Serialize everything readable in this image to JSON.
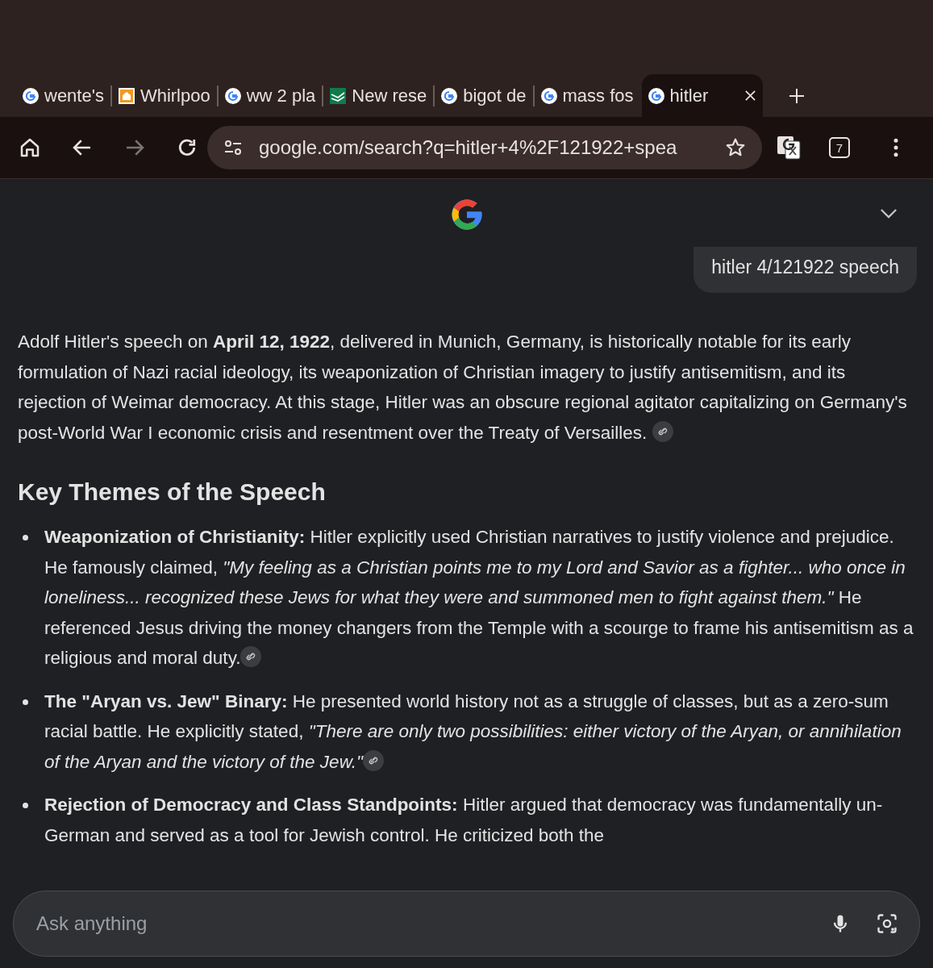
{
  "browser": {
    "tabs": [
      {
        "title": "wente's",
        "kind": "google",
        "selected": false
      },
      {
        "title": "Whirlpoo",
        "kind": "house",
        "selected": false
      },
      {
        "title": "ww 2 pla",
        "kind": "google",
        "selected": false
      },
      {
        "title": "New rese",
        "kind": "sheet",
        "selected": false
      },
      {
        "title": "bigot de",
        "kind": "google",
        "selected": false
      },
      {
        "title": "mass fos",
        "kind": "google",
        "selected": false
      },
      {
        "title": "hitler",
        "kind": "google",
        "selected": true
      }
    ],
    "address": "google.com/search?q=hitler+4%2F121922+spea",
    "tab_count": "7"
  },
  "query": "hitler 4/121922 speech",
  "answer": {
    "intro": "Adolf Hitler's speech on **April 12, 1922**, delivered in Munich, Germany, is historically notable for its early formulation of Nazi racial ideology, its weaponization of Christian imagery to justify antisemitism, and its rejection of Weimar democracy. At this stage, Hitler was an obscure regional agitator capitalizing on Germany's post-World War I economic crisis and resentment over the Treaty of Versailles.",
    "heading": "Key Themes of the Speech",
    "bullets": [
      {
        "label": "Weaponization of Christianity:",
        "text": "Hitler explicitly used Christian narratives to justify violence and prejudice. He famously claimed, *\"My feeling as a Christian points me to my Lord and Savior as a fighter... who once in loneliness... recognized these Jews for what they were and summoned men to fight against them.\"* He referenced Jesus driving the money changers from the Temple with a scourge to frame his antisemitism as a religious and moral duty.",
        "cited": true
      },
      {
        "label": "The \"Aryan vs. Jew\" Binary:",
        "text": "He presented world history not as a struggle of classes, but as a zero-sum racial battle. He explicitly stated, *\"There are only two possibilities: either victory of the Aryan, or annihilation of the Aryan and the victory of the Jew.\"*",
        "cited": true
      },
      {
        "label": "Rejection of Democracy and Class Standpoints:",
        "text": "Hitler argued that democracy was fundamentally un-German and served as a tool for Jewish control. He criticized both the"
      }
    ]
  },
  "input": {
    "placeholder": "Ask anything"
  }
}
